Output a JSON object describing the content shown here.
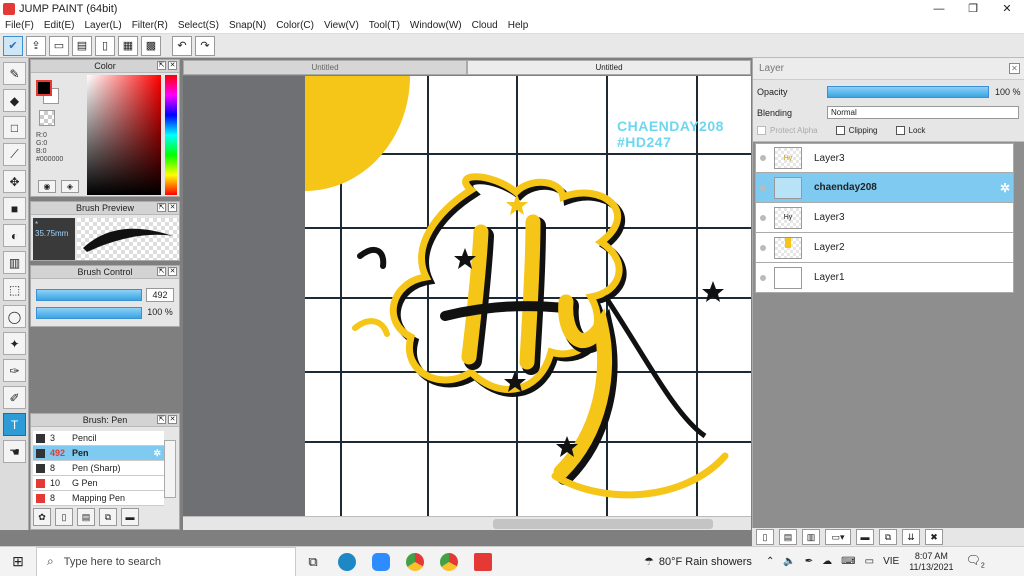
{
  "window": {
    "title": "JUMP PAINT (64bit)",
    "min": "—",
    "max": "❐",
    "close": "✕"
  },
  "menu": [
    "File(F)",
    "Edit(E)",
    "Layer(L)",
    "Filter(R)",
    "Select(S)",
    "Snap(N)",
    "Color(C)",
    "View(V)",
    "Tool(T)",
    "Window(W)",
    "Cloud",
    "Help"
  ],
  "color_panel": {
    "title": "Color",
    "r": "R:0",
    "g": "G:0",
    "b": "B:0",
    "hex": "#000000",
    "fg": "#000000",
    "bg": "#ffffff"
  },
  "brush_preview": {
    "title": "Brush Preview",
    "size": "35.75mm"
  },
  "brush_control": {
    "title": "Brush Control",
    "size_value": "492",
    "opacity_value": "100 %",
    "size_fraction": 0.95,
    "opacity_fraction": 1.0
  },
  "brush_list": {
    "title": "Brush: Pen",
    "items": [
      {
        "num": "3",
        "name": "Pencil",
        "color": "#333333"
      },
      {
        "num": "492",
        "name": "Pen",
        "color": "#333333",
        "selected": true
      },
      {
        "num": "8",
        "name": "Pen (Sharp)",
        "color": "#333333"
      },
      {
        "num": "10",
        "name": "G Pen",
        "color": "#e53935"
      },
      {
        "num": "8",
        "name": "Mapping Pen",
        "color": "#e53935"
      }
    ]
  },
  "tabs": [
    {
      "label": "Untitled"
    },
    {
      "label": "Untitled"
    }
  ],
  "canvas": {
    "watermark_line1": "CHAENDAY208",
    "watermark_line2": "#HD247",
    "lettering": "Hy",
    "accent": "#f5c518"
  },
  "layer_panel": {
    "title": "Layer",
    "opacity_label": "Opacity",
    "opacity_value": "100 %",
    "blending_label": "Blending",
    "blending_value": "Normal",
    "protect_alpha": "Protect Alpha",
    "clipping": "Clipping",
    "lock": "Lock",
    "layers": [
      {
        "name": "Layer3",
        "thumb": "Hy"
      },
      {
        "name": "chaenday208",
        "thumb": "",
        "selected": true
      },
      {
        "name": "Layer3",
        "thumb": "Hy"
      },
      {
        "name": "Layer2",
        "thumb": ""
      },
      {
        "name": "Layer1",
        "thumb": ""
      }
    ]
  },
  "taskbar": {
    "search_placeholder": "Type here to search",
    "weather": "80°F  Rain showers",
    "lang": "VIE",
    "time": "8:07 AM",
    "date": "11/13/2021",
    "notif_count": "2"
  }
}
